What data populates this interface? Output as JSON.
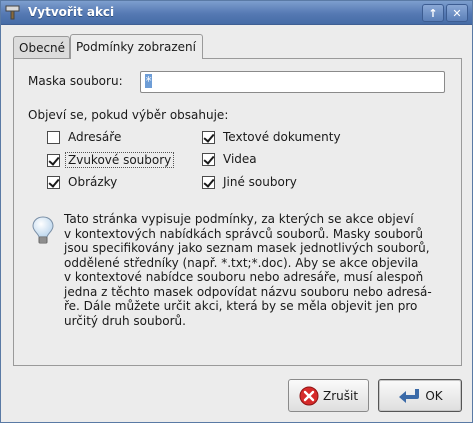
{
  "window": {
    "title": "Vytvořit akci",
    "up_button": "↑",
    "close_button": "✕"
  },
  "tabs": [
    {
      "label": "Obecné",
      "active": false
    },
    {
      "label": "Podmínky zobrazení",
      "active": true
    }
  ],
  "mask": {
    "label": "Maska souboru:",
    "value": "*"
  },
  "group_label": "Objeví se, pokud výběr obsahuje:",
  "checkboxes": [
    {
      "label": "Adresáře",
      "checked": false
    },
    {
      "label": "Zvukové soubory",
      "checked": true
    },
    {
      "label": "Obrázky",
      "checked": true
    },
    {
      "label": "Textové dokumenty",
      "checked": true
    },
    {
      "label": "Videa",
      "checked": true
    },
    {
      "label": "Jiné soubory",
      "checked": true
    }
  ],
  "info": {
    "icon": "lightbulb-icon",
    "text": "Tato stránka vypisuje podmínky, za kterých se akce objeví\nv kontextových nabídkách správců souborů. Masky souborů\njsou specifikovány jako seznam masek jednotlivých souborů,\noddělené středníky (např. *.txt;*.doc). Aby se akce objevila\nv kontextové nabídce souboru nebo adresáře, musí alespoň\njedna z těchto masek odpovídat názvu souboru nebo adresá-\nře. Dále můžete určit akci, která by se měla objevit jen pro\nurčitý druh souborů."
  },
  "buttons": {
    "cancel": "Zrušit",
    "ok": "OK"
  },
  "colors": {
    "titlebar": "#5579b3",
    "selection": "#6e9dd6"
  }
}
